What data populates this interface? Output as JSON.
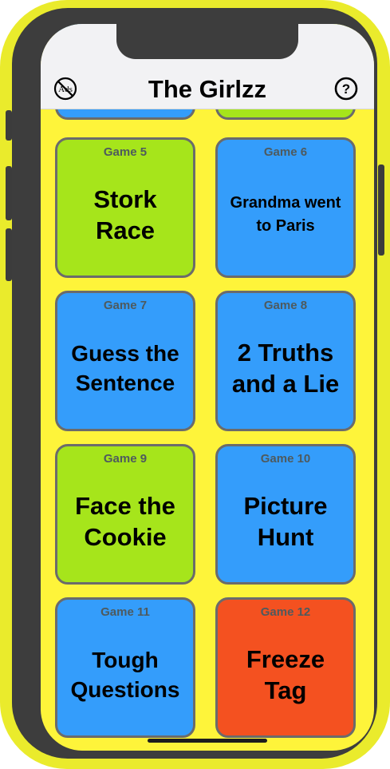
{
  "header": {
    "title": "The Girlzz",
    "noads_icon_text": "Ads",
    "help_icon_text": "?"
  },
  "colors": {
    "green": "#a6e51b",
    "blue": "#349dfb",
    "orange": "#f45120",
    "yellow": "#fef43a",
    "frame": "#eaeb2c",
    "bezel": "#3d3d3d",
    "header_bg": "#f2f2f4"
  },
  "games": [
    {
      "number_label": "Game 5",
      "name": "Stork Race",
      "color": "green"
    },
    {
      "number_label": "Game 6",
      "name": "Grandma went to Paris",
      "color": "blue"
    },
    {
      "number_label": "Game 7",
      "name": "Guess the Sentence",
      "color": "blue"
    },
    {
      "number_label": "Game 8",
      "name": "2 Truths and a Lie",
      "color": "blue"
    },
    {
      "number_label": "Game 9",
      "name": "Face the Cookie",
      "color": "green"
    },
    {
      "number_label": "Game 10",
      "name": "Picture Hunt",
      "color": "blue"
    },
    {
      "number_label": "Game 11",
      "name": "Tough Questions",
      "color": "blue"
    },
    {
      "number_label": "Game 12",
      "name": "Freeze Tag",
      "color": "orange"
    }
  ]
}
